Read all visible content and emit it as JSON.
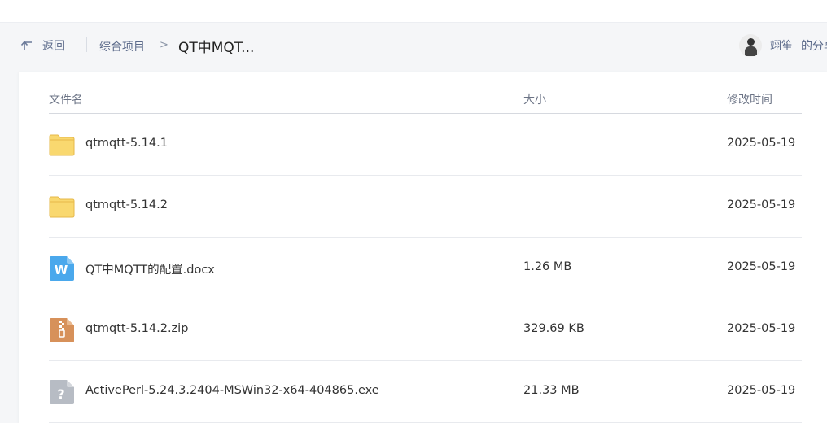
{
  "header": {
    "back_label": "返回",
    "crumb_root": "综合项目",
    "crumb_separator": ">",
    "crumb_current": "QT中MQT...",
    "owner_name": "翊笙",
    "owner_suffix": "的分享"
  },
  "table": {
    "columns": {
      "name": "文件名",
      "size": "大小",
      "modified": "修改时间"
    },
    "rows": [
      {
        "name": "qtmqtt-5.14.1",
        "size": "",
        "date": "2025-05-19",
        "icon": "folder-icon"
      },
      {
        "name": "qtmqtt-5.14.2",
        "size": "",
        "date": "2025-05-19",
        "icon": "folder-icon"
      },
      {
        "name": "QT中MQTT的配置.docx",
        "size": "1.26 MB",
        "date": "2025-05-19",
        "icon": "word-doc-icon"
      },
      {
        "name": "qtmqtt-5.14.2.zip",
        "size": "329.69 KB",
        "date": "2025-05-19",
        "icon": "zip-archive-icon"
      },
      {
        "name": "ActivePerl-5.24.3.2404-MSWin32-x64-404865.exe",
        "size": "21.33 MB",
        "date": "2025-05-19",
        "icon": "unknown-file-icon"
      }
    ]
  },
  "colors": {
    "folder": "#f9d86f",
    "word": "#4aa8ec",
    "zip": "#d7915a",
    "unknown": "#b7bcc4",
    "link": "#5b6a8a"
  }
}
